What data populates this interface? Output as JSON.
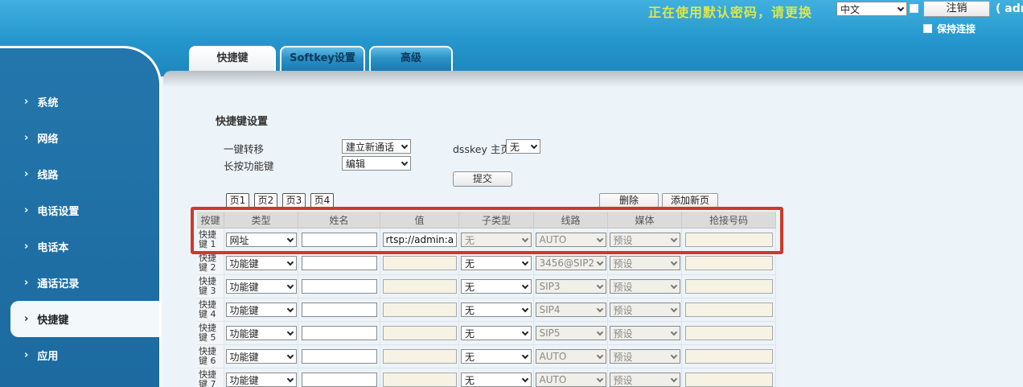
{
  "topbar": {
    "warning": "正在使用默认密码，请更换",
    "language": "中文",
    "logout": "注销",
    "admin_hint": "( adm",
    "keep_alive": "保持连接"
  },
  "sidebar": {
    "items": [
      {
        "label": "系统"
      },
      {
        "label": "网络"
      },
      {
        "label": "线路"
      },
      {
        "label": "电话设置"
      },
      {
        "label": "电话本"
      },
      {
        "label": "通话记录"
      },
      {
        "label": "快捷键"
      },
      {
        "label": "应用"
      }
    ],
    "active_item": "快捷键",
    "arrow": "›"
  },
  "tabs": [
    {
      "label": "快捷键",
      "active": true
    },
    {
      "label": "Softkey设置",
      "active": false
    },
    {
      "label": "高级",
      "active": false
    }
  ],
  "form": {
    "title": "快捷键设置",
    "transfer_label": "一键转移",
    "transfer_value": "建立新通话",
    "dsskey_label": "dsskey 主页:",
    "dsskey_value": "无",
    "longpress_label": "长按功能键",
    "longpress_value": "编辑",
    "submit": "提交"
  },
  "pager": {
    "pages": [
      "页1",
      "页2",
      "页3",
      "页4"
    ],
    "delete": "删除",
    "add_page": "添加新页"
  },
  "table": {
    "headers": [
      "按键",
      "类型",
      "姓名",
      "值",
      "子类型",
      "线路",
      "媒体",
      "抢接号码"
    ],
    "rows": [
      {
        "key": "快捷键 1",
        "type": "网址",
        "name": "",
        "value": "rtsp://admin:admin",
        "subtype": "无",
        "line": "AUTO",
        "media": "预设",
        "pickup": ""
      },
      {
        "key": "快捷键 2",
        "type": "功能键",
        "name": "",
        "value": "",
        "subtype": "无",
        "line": "3456@SIP2",
        "media": "预设",
        "pickup": ""
      },
      {
        "key": "快捷键 3",
        "type": "功能键",
        "name": "",
        "value": "",
        "subtype": "无",
        "line": "SIP3",
        "media": "预设",
        "pickup": ""
      },
      {
        "key": "快捷键 4",
        "type": "功能键",
        "name": "",
        "value": "",
        "subtype": "无",
        "line": "SIP4",
        "media": "预设",
        "pickup": ""
      },
      {
        "key": "快捷键 5",
        "type": "功能键",
        "name": "",
        "value": "",
        "subtype": "无",
        "line": "SIP5",
        "media": "预设",
        "pickup": ""
      },
      {
        "key": "快捷键 6",
        "type": "功能键",
        "name": "",
        "value": "",
        "subtype": "无",
        "line": "AUTO",
        "media": "预设",
        "pickup": ""
      },
      {
        "key": "快捷键 7",
        "type": "功能键",
        "name": "",
        "value": "",
        "subtype": "无",
        "line": "AUTO",
        "media": "预设",
        "pickup": ""
      }
    ]
  },
  "colors": {
    "highlight_red": "#cf392a",
    "warning_yellow": "#d8e74e",
    "topbar_blue": "#2496cc",
    "sidebar_blue": "#1c6aa0",
    "disabled_input_bg": "#f7f3e4",
    "disabled_select_bg": "#f0efe9"
  }
}
